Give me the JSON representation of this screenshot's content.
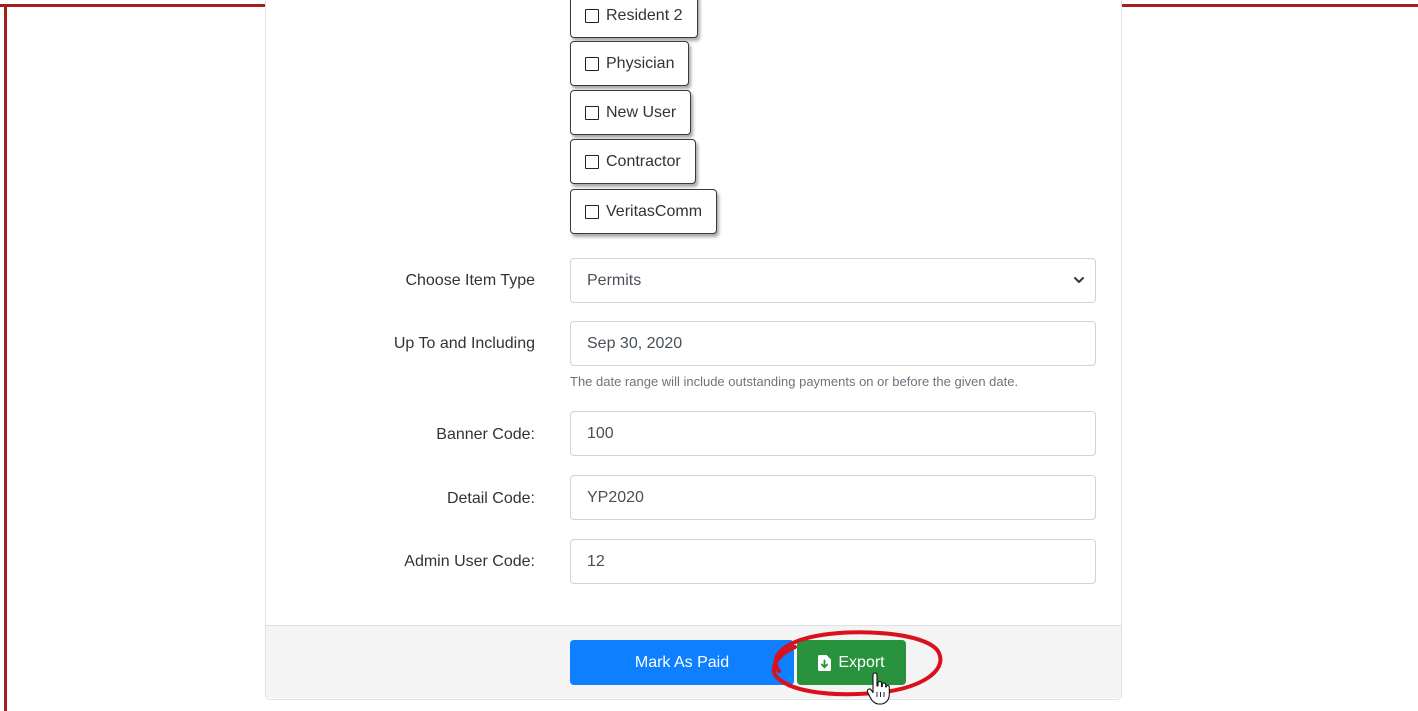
{
  "roles": [
    "Resident 2",
    "Physician",
    "New User",
    "Contractor",
    "VeritasComm"
  ],
  "item_type": {
    "label": "Choose Item Type",
    "value": "Permits"
  },
  "date": {
    "label": "Up To and Including",
    "value": "Sep 30, 2020",
    "help": "The date range will include outstanding payments on or before the given date."
  },
  "banner": {
    "label": "Banner Code:",
    "value": "100"
  },
  "detail": {
    "label": "Detail Code:",
    "value": "YP2020"
  },
  "admin": {
    "label": "Admin User Code:",
    "value": "12"
  },
  "buttons": {
    "mark_paid": "Mark As Paid",
    "export": "Export"
  },
  "colors": {
    "primary": "#0d7fff",
    "success": "#28923d",
    "highlight": "#d9111c",
    "frame": "#a3201e"
  }
}
